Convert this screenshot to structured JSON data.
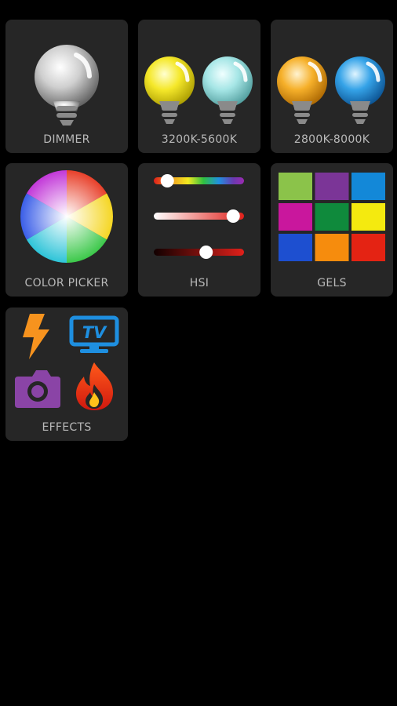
{
  "colors": {
    "background": "#000000",
    "tile": "#262626",
    "label": "#b9b9b9"
  },
  "tiles": [
    {
      "id": "dimmer",
      "label": "DIMMER",
      "icon": "white-bulb-icon"
    },
    {
      "id": "bicolor_3200_5600",
      "label": "3200K-5600K",
      "icon": "yellow-and-cyan-bulbs-icon"
    },
    {
      "id": "bicolor_2800_8000",
      "label": "2800K-8000K",
      "icon": "orange-and-blue-bulbs-icon"
    },
    {
      "id": "color_picker",
      "label": "COLOR PICKER",
      "icon": "color-wheel-icon"
    },
    {
      "id": "hsi",
      "label": "HSI",
      "icon": "hsi-sliders-icon"
    },
    {
      "id": "gels",
      "label": "GELS",
      "icon": "gel-swatch-grid-icon",
      "swatches": [
        "#8bc34a",
        "#7b3597",
        "#1388d8",
        "#c9179d",
        "#0f8a3c",
        "#f4ea0f",
        "#1d4fd0",
        "#f68c0d",
        "#e42313"
      ]
    },
    {
      "id": "effects",
      "label": "EFFECTS",
      "icon": "effects-icon",
      "effect_icons": [
        "lightning-icon",
        "tv-icon",
        "camera-icon",
        "fire-icon"
      ]
    }
  ],
  "hsi": {
    "hue": 0.15,
    "saturation": 0.88,
    "intensity": 0.58
  }
}
